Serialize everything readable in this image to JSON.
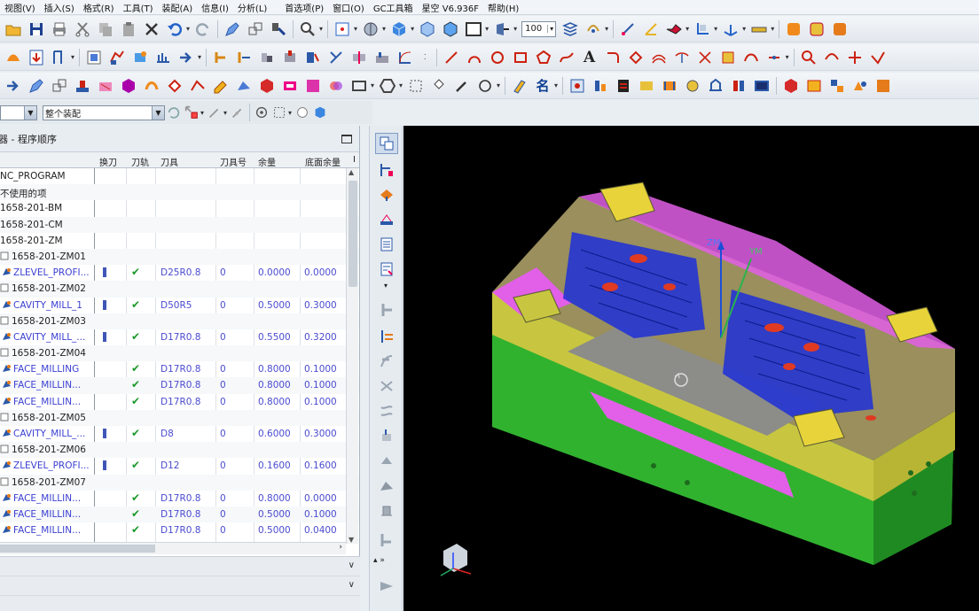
{
  "menu": [
    "视图(V)",
    "插入(S)",
    "格式(R)",
    "工具(T)",
    "装配(A)",
    "信息(I)",
    "分析(L)",
    "首选项(P)",
    "窗口(O)",
    "GC工具箱",
    "星空 V6.936F",
    "帮助(H)"
  ],
  "toolbar": {
    "zoom_value": "100",
    "text_tool": "A",
    "name_tool": "名"
  },
  "filter": {
    "left_value": "",
    "right_value": "整个装配"
  },
  "navigator": {
    "title": "工序导航器 - 程序顺序",
    "columns": [
      "换刀",
      "刀轨",
      "刀具",
      "刀具号",
      "余量",
      "底面余量",
      "I"
    ],
    "rows": [
      {
        "name": "NC_PROGRAM",
        "type": "root",
        "tool": "",
        "toolno": "",
        "stock": "",
        "floor": ""
      },
      {
        "name": "不使用的项",
        "type": "group",
        "tool": "",
        "toolno": "",
        "stock": "",
        "floor": ""
      },
      {
        "name": "1658-201-BM",
        "type": "group",
        "tool": "",
        "toolno": "",
        "stock": "",
        "floor": ""
      },
      {
        "name": "1658-201-CM",
        "type": "group",
        "tool": "",
        "toolno": "",
        "stock": "",
        "floor": ""
      },
      {
        "name": "1658-201-ZM",
        "type": "group",
        "tool": "",
        "toolno": "",
        "stock": "",
        "floor": ""
      },
      {
        "name": "1658-201-ZM01",
        "type": "program",
        "tool": "",
        "toolno": "",
        "stock": "",
        "floor": ""
      },
      {
        "name": "ZLEVEL_PROFI...",
        "type": "op",
        "tool": "D25R0.8",
        "toolno": "0",
        "stock": "0.0000",
        "floor": "0.0000",
        "change": true
      },
      {
        "name": "1658-201-ZM02",
        "type": "program",
        "tool": "",
        "toolno": "",
        "stock": "",
        "floor": ""
      },
      {
        "name": "CAVITY_MILL_1",
        "type": "op",
        "tool": "D50R5",
        "toolno": "0",
        "stock": "0.5000",
        "floor": "0.3000",
        "change": true
      },
      {
        "name": "1658-201-ZM03",
        "type": "program",
        "tool": "",
        "toolno": "",
        "stock": "",
        "floor": ""
      },
      {
        "name": "CAVITY_MILL_...",
        "type": "op",
        "tool": "D17R0.8",
        "toolno": "0",
        "stock": "0.5500",
        "floor": "0.3200",
        "change": true
      },
      {
        "name": "1658-201-ZM04",
        "type": "program",
        "tool": "",
        "toolno": "",
        "stock": "",
        "floor": ""
      },
      {
        "name": "FACE_MILLING",
        "type": "op",
        "tool": "D17R0.8",
        "toolno": "0",
        "stock": "0.8000",
        "floor": "0.1000",
        "change": false
      },
      {
        "name": "FACE_MILLIN...",
        "type": "op",
        "tool": "D17R0.8",
        "toolno": "0",
        "stock": "0.8000",
        "floor": "0.1000",
        "change": false
      },
      {
        "name": "FACE_MILLIN...",
        "type": "op",
        "tool": "D17R0.8",
        "toolno": "0",
        "stock": "0.8000",
        "floor": "0.1000",
        "change": false
      },
      {
        "name": "1658-201-ZM05",
        "type": "program",
        "tool": "",
        "toolno": "",
        "stock": "",
        "floor": ""
      },
      {
        "name": "CAVITY_MILL_...",
        "type": "op",
        "tool": "D8",
        "toolno": "0",
        "stock": "0.6000",
        "floor": "0.3000",
        "change": true
      },
      {
        "name": "1658-201-ZM06",
        "type": "program",
        "tool": "",
        "toolno": "",
        "stock": "",
        "floor": ""
      },
      {
        "name": "ZLEVEL_PROFI...",
        "type": "op",
        "tool": "D12",
        "toolno": "0",
        "stock": "0.1600",
        "floor": "0.1600",
        "change": true
      },
      {
        "name": "1658-201-ZM07",
        "type": "program",
        "tool": "",
        "toolno": "",
        "stock": "",
        "floor": ""
      },
      {
        "name": "FACE_MILLIN...",
        "type": "op",
        "tool": "D17R0.8",
        "toolno": "0",
        "stock": "0.8000",
        "floor": "0.0000",
        "change": false
      },
      {
        "name": "FACE_MILLIN...",
        "type": "op",
        "tool": "D17R0.8",
        "toolno": "0",
        "stock": "0.5000",
        "floor": "0.1000",
        "change": false
      },
      {
        "name": "FACE_MILLIN...",
        "type": "op",
        "tool": "D17R0.8",
        "toolno": "0",
        "stock": "0.5000",
        "floor": "0.0400",
        "change": false
      }
    ]
  },
  "viewport": {
    "axis_labels": {
      "zm": "ZM",
      "ym": "YM"
    },
    "colors": {
      "background": "#000000",
      "mold_top": "#9a8f5d",
      "mold_side": "#c8c640",
      "mold_base": "#2dad2c",
      "wall_magenta": "#e25fe8",
      "toolpath": "#1d2fd8"
    }
  }
}
